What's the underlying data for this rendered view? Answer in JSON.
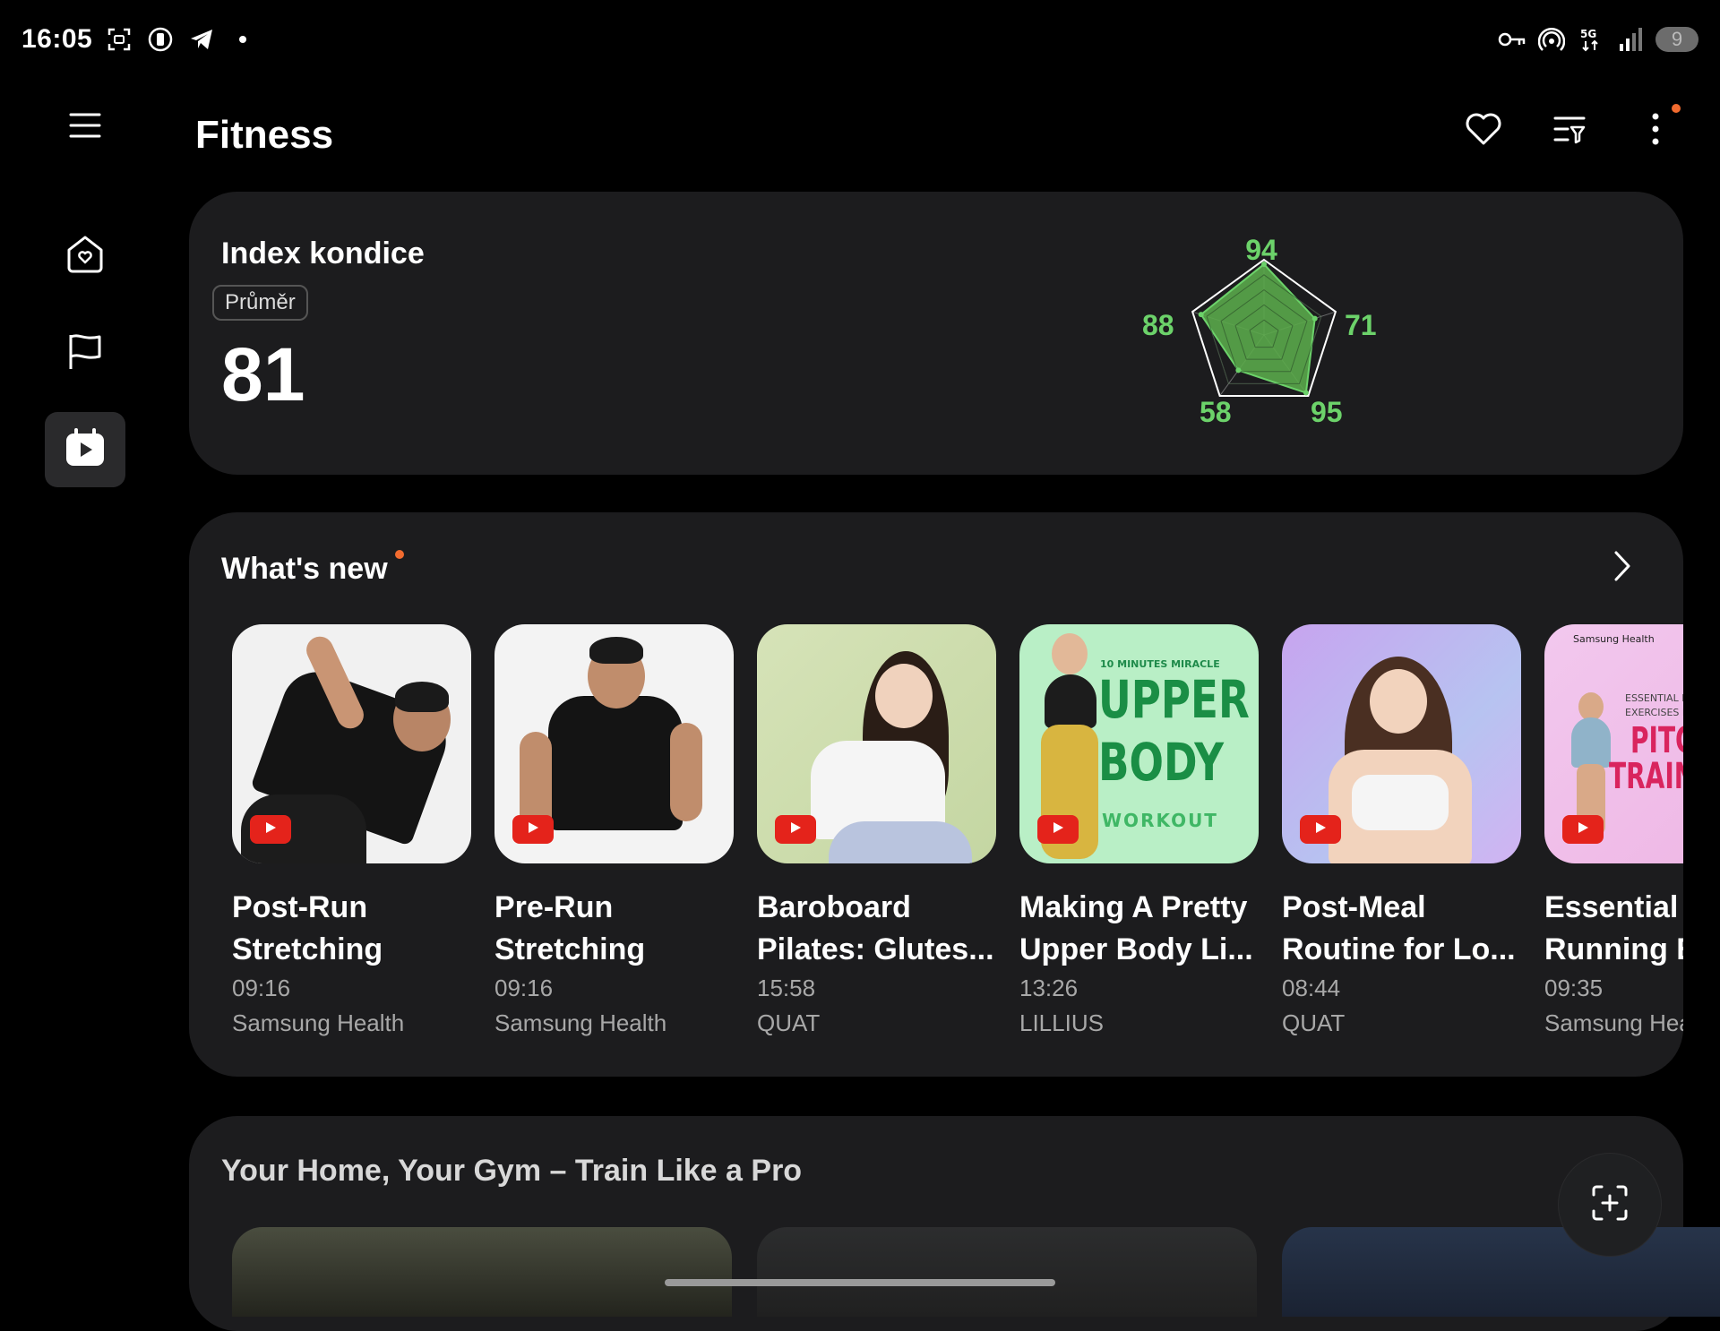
{
  "status_bar": {
    "time": "16:05",
    "battery": "9",
    "icons": [
      "screenshot-icon",
      "watch-icon",
      "telegram-icon",
      "dot-icon",
      "vpn-key-icon",
      "hotspot-icon",
      "5g-icon",
      "signal-icon"
    ]
  },
  "app": {
    "title": "Fitness"
  },
  "nav_rail": {
    "items": [
      "menu-icon",
      "home-heart-icon",
      "flag-icon",
      "video-icon"
    ],
    "active": "video-icon"
  },
  "top_actions": [
    "heart-icon",
    "filter-icon",
    "more-icon"
  ],
  "fitness_index": {
    "title": "Index kondice",
    "badge": "Průměr",
    "value": "81",
    "radar_values": {
      "top": "94",
      "right": "71",
      "bottom_right": "95",
      "bottom_left": "58",
      "left": "88"
    }
  },
  "chart_data": {
    "type": "radar",
    "values": [
      94,
      71,
      95,
      58,
      88
    ],
    "labels": [
      "94",
      "71",
      "95",
      "58",
      "88"
    ],
    "color": "#5aa84a"
  },
  "whats_new": {
    "title": "What's new",
    "videos": [
      {
        "title_line1": "Post-Run",
        "title_line2": "Stretching",
        "duration": "09:16",
        "source": "Samsung Health"
      },
      {
        "title_line1": "Pre-Run",
        "title_line2": "Stretching",
        "duration": "09:16",
        "source": "Samsung Health"
      },
      {
        "title_line1": "Baroboard",
        "title_line2": "Pilates: Glutes...",
        "duration": "15:58",
        "source": "QUAT"
      },
      {
        "title_line1": "Making A Pretty",
        "title_line2": "Upper Body Li...",
        "duration": "13:26",
        "source": "LILLIUS"
      },
      {
        "title_line1": "Post-Meal",
        "title_line2": "Routine for Lo...",
        "duration": "08:44",
        "source": "QUAT"
      },
      {
        "title_line1": "Essential",
        "title_line2": "Running E",
        "duration": "09:35",
        "source": "Samsung Hea"
      }
    ],
    "thumb_texts": {
      "upper_small": "10 MINUTES MIRACLE",
      "upper": "UPPER",
      "body": "BODY",
      "workout": "WORKOUT",
      "samsung_health": "Samsung Health",
      "essential_run": "ESSENTIAL RUN",
      "exercises": "EXERCISES PAR",
      "pitch": "PITC",
      "training": "TRAINI"
    }
  },
  "gym_section": {
    "title": "Your Home, Your Gym – Train Like a Pro"
  },
  "colors": {
    "accent_green": "#6cd26a",
    "notification": "#f26b2f",
    "youtube_red": "#e4231b",
    "card_bg": "#1c1c1e"
  }
}
